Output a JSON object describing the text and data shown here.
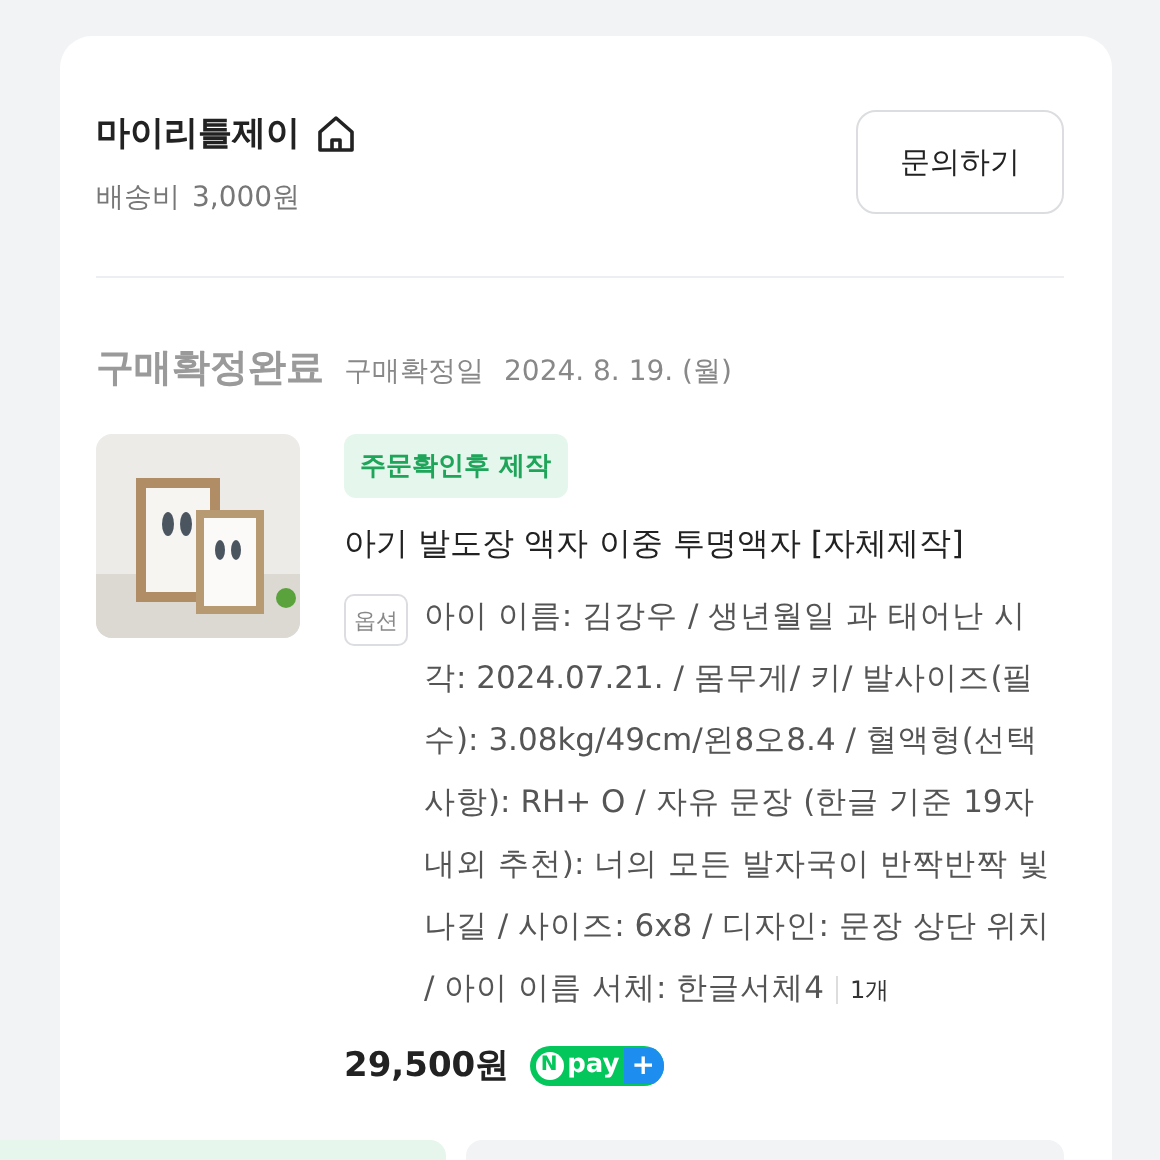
{
  "store": {
    "name": "마이리틀제이",
    "shipping_label": "배송비",
    "shipping_fee": "3,000원",
    "contact_button": "문의하기"
  },
  "order": {
    "status": "구매확정완료",
    "date_label": "구매확정일",
    "date": "2024. 8. 19. (월)",
    "item": {
      "tag": "주문확인후 제작",
      "title": "아기 발도장 액자 이중 투명액자 [자체제작]",
      "option_label": "옵션",
      "option_text": "아이 이름: 김강우 / 생년월일 과 태어난 시각: 2024.07.21. / 몸무게/ 키/ 발사이즈(필수): 3.08kg/49cm/왼8오8.4 / 혈액형(선택사항): RH+ O / 자유 문장 (한글 기준 19자 내외 추천): 너의 모든 발자국이 반짝반짝 빛나길 / 사이즈: 6x8 / 디자인: 문장 상단 위치 / 아이 이름 서체: 한글서체4",
      "quantity": "1개",
      "price": "29,500원",
      "npay": {
        "letter": "N",
        "text": "pay",
        "plus": "+"
      }
    }
  }
}
